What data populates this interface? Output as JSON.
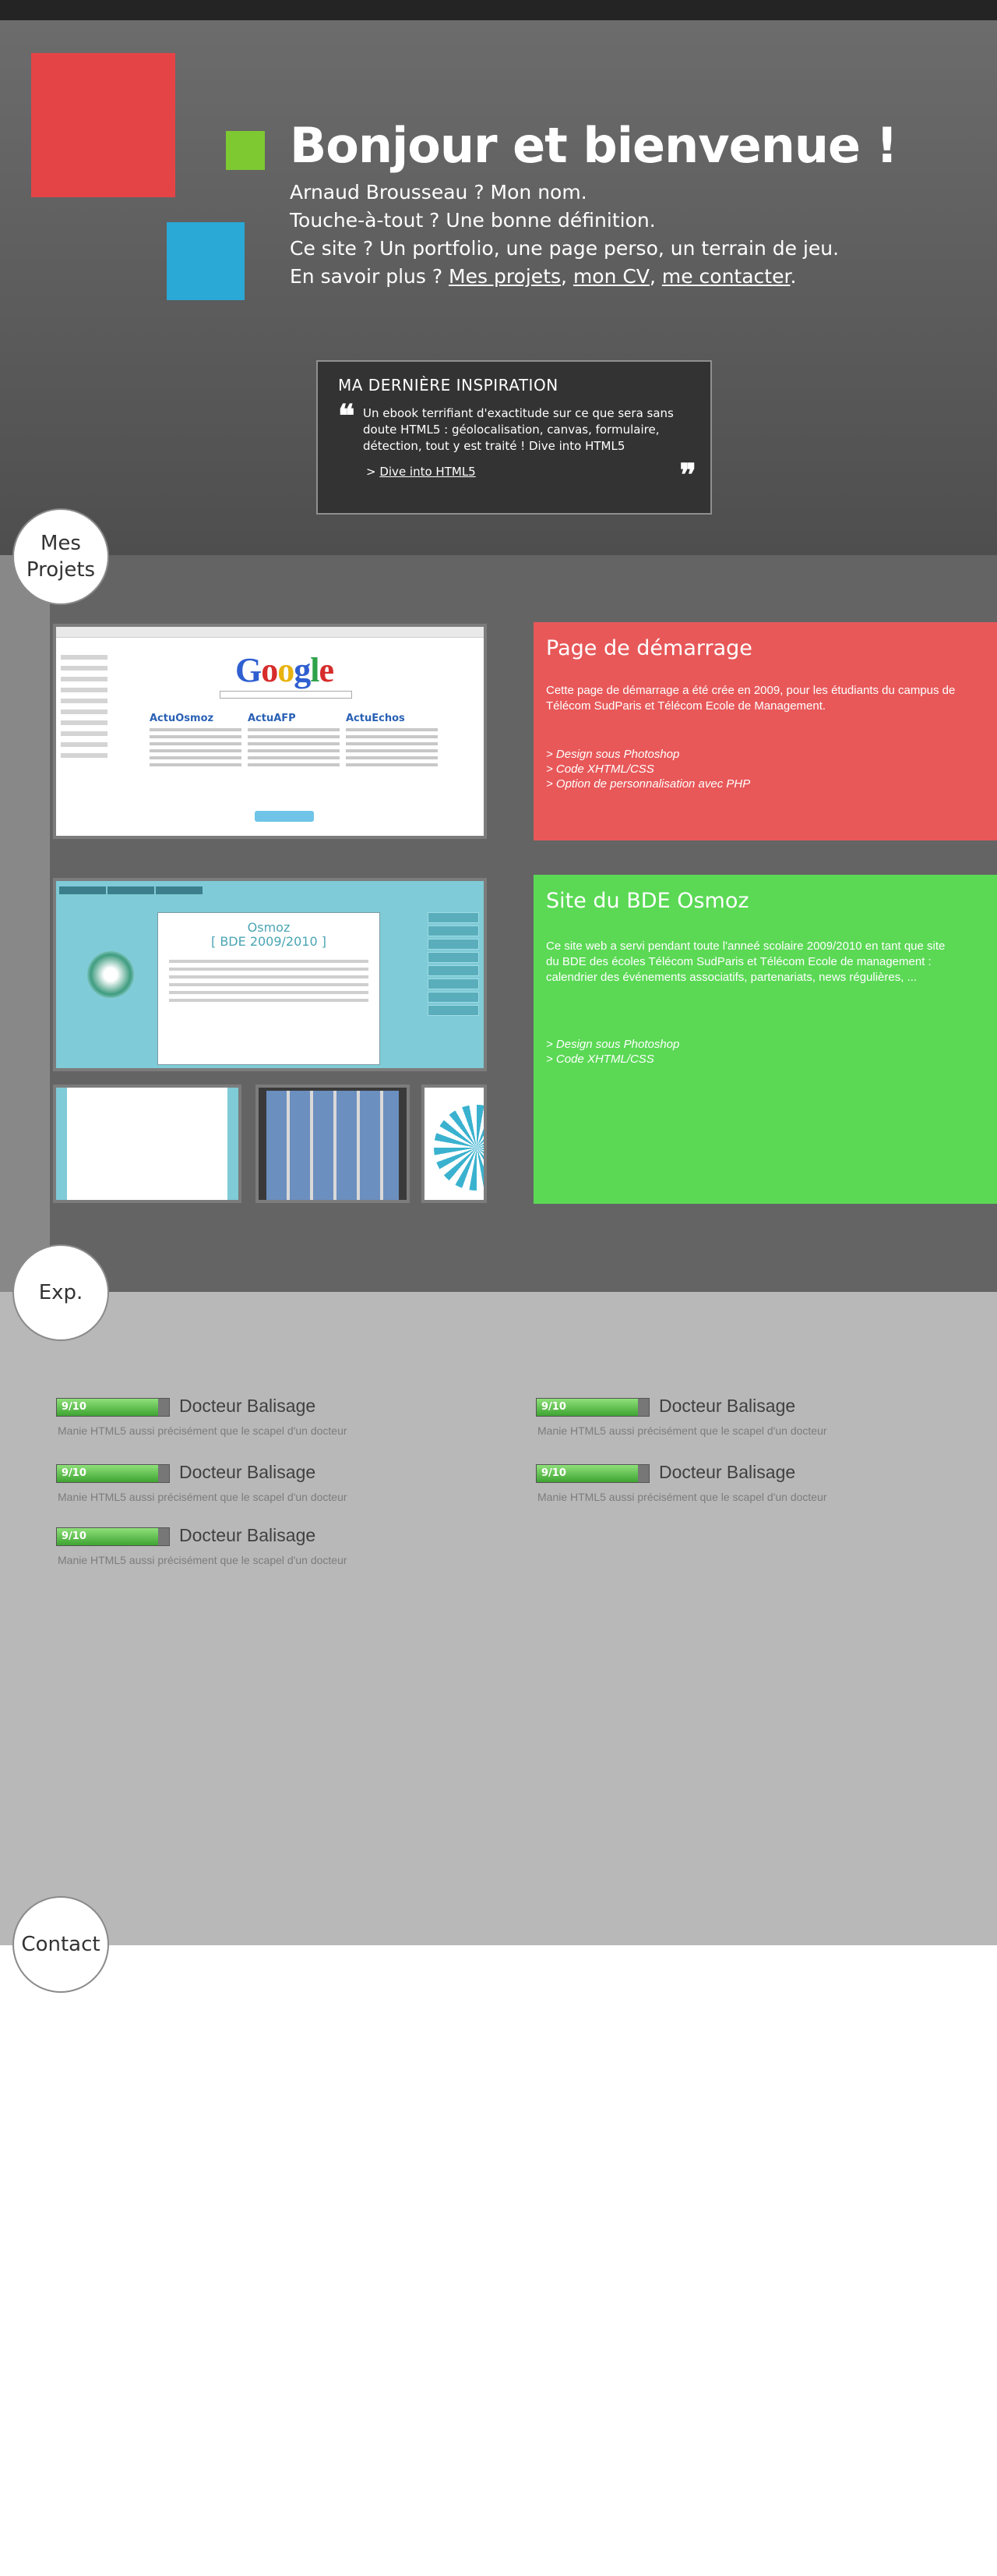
{
  "colors": {
    "red_square": "#e54447",
    "blue_square": "#2aa8d6",
    "green_square": "#7ec932",
    "card_red": "#e85859",
    "card_green": "#5bd955",
    "skill_fill": "#4fbc3f"
  },
  "hero": {
    "title": "Bonjour et bienvenue !",
    "line1": "Arnaud Brousseau ? Mon nom.",
    "line2": "Touche-à-tout ? Une bonne définition.",
    "line3": "Ce site ? Un portfolio, une page perso, un terrain de jeu.",
    "line4_prefix": "En savoir plus ? ",
    "link_projects": "Mes projets",
    "sep1": ", ",
    "link_cv": "mon CV",
    "sep2": ", ",
    "link_contact": "me contacter",
    "line4_end": "."
  },
  "inspiration": {
    "title": "MA DERNIÈRE INSPIRATION",
    "quote_open": "❝",
    "text": "Un ebook terrifiant d'exactitude sur ce que sera sans doute HTML5 : géolocalisation, canvas, formulaire, détection, tout y est traité ! Dive into HTML5",
    "link_prefix": "> ",
    "link": "Dive into HTML5",
    "quote_close": "❞"
  },
  "sections": {
    "projects": "Mes\nProjets",
    "exp": "Exp.",
    "contact": "Contact"
  },
  "projects": [
    {
      "title": "Page de démarrage",
      "description": "Cette page de démarrage a été crée en 2009, pour les étudiants du campus de Télécom SudParis et Télécom Ecole de Management.",
      "items": [
        "> Design sous Photoshop",
        "> Code XHTML/CSS",
        "> Option de personnalisation avec PHP"
      ]
    },
    {
      "title": "Site du BDE Osmoz",
      "description": "Ce site web a servi pendant toute l'anneé scolaire 2009/2010 en tant que site du BDE des écoles Télécom SudParis et Télécom Ecole de management : calendrier des événements associatifs, partenariats, news régulières, ...",
      "items": [
        "> Design sous Photoshop",
        "> Code XHTML/CSS"
      ]
    }
  ],
  "screenshots": {
    "google_cols": [
      "ActuOsmoz",
      "ActuAFP",
      "ActuEchos"
    ],
    "osmoz_title": "Osmoz\n[ BDE 2009/2010 ]"
  },
  "skills": [
    {
      "score": "9/10",
      "level": 0.9,
      "name": "Docteur Balisage",
      "desc": "Manie HTML5 aussi précisément que le scapel d'un docteur"
    },
    {
      "score": "9/10",
      "level": 0.9,
      "name": "Docteur Balisage",
      "desc": "Manie HTML5 aussi précisément que le scapel d'un docteur"
    },
    {
      "score": "9/10",
      "level": 0.9,
      "name": "Docteur Balisage",
      "desc": "Manie HTML5 aussi précisément que le scapel d'un docteur"
    },
    {
      "score": "9/10",
      "level": 0.9,
      "name": "Docteur Balisage",
      "desc": "Manie HTML5 aussi précisément que le scapel d'un docteur"
    },
    {
      "score": "9/10",
      "level": 0.9,
      "name": "Docteur Balisage",
      "desc": "Manie HTML5 aussi précisément que le scapel d'un docteur"
    }
  ]
}
